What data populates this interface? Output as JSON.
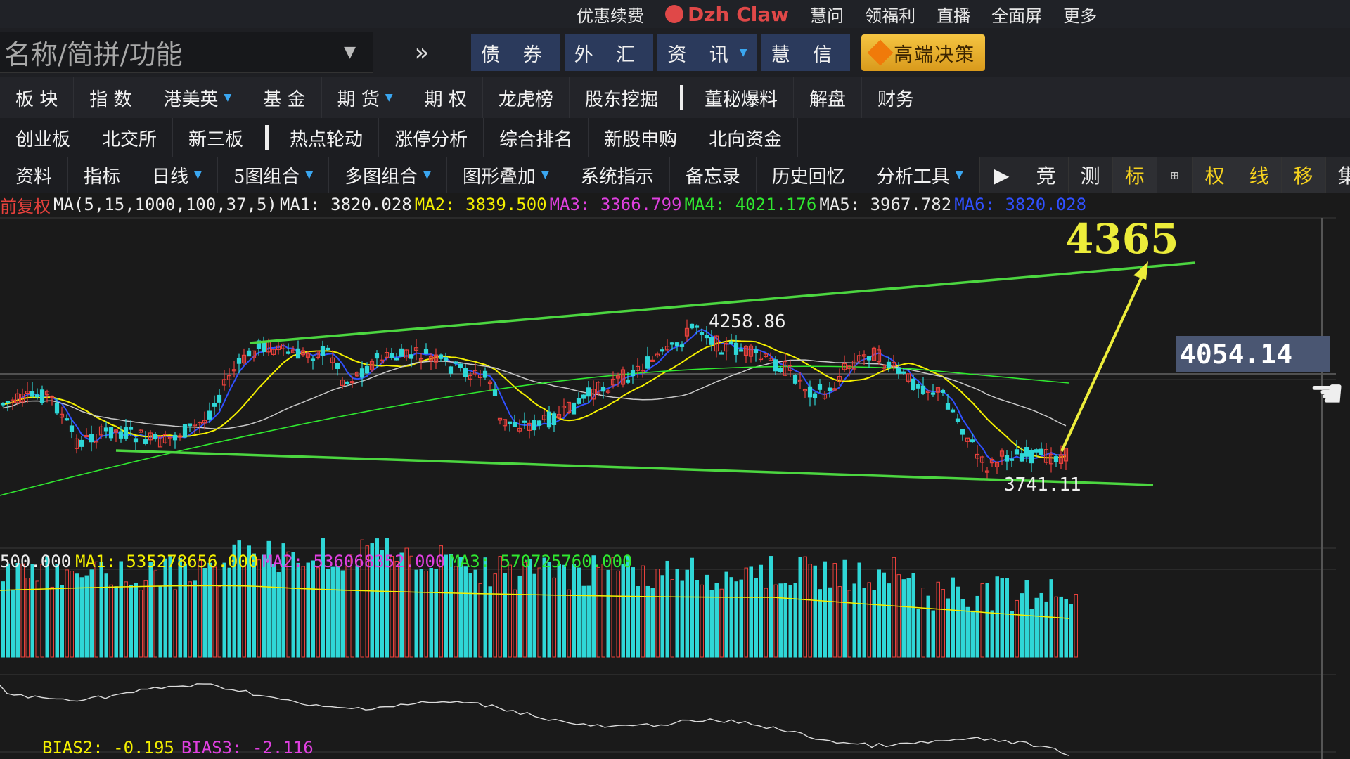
{
  "colors": {
    "up": "#e8413c",
    "down": "#2fd7d7",
    "channel": "#4cd640",
    "arrow": "#ecec3a",
    "ma1": "#f0f0f0",
    "ma2": "#f4f000",
    "ma3": "#e040e0",
    "ma4": "#30e830",
    "ma5": "#e8e8e8",
    "ma6": "#3050ff"
  },
  "topbar": {
    "promo": "优惠续费",
    "brand": "Dzh Claw",
    "items": [
      "慧问",
      "领福利",
      "直播",
      "全面屏",
      "更多"
    ]
  },
  "search": {
    "placeholder": "名称/简拼/功能",
    "more": "»"
  },
  "markets": [
    {
      "label": "债 券"
    },
    {
      "label": "外 汇"
    },
    {
      "label": "资 讯",
      "dropdown": true
    },
    {
      "label": "慧 信"
    }
  ],
  "premium": {
    "label": "高端决策",
    "icon": "diamond-icon"
  },
  "row2": [
    {
      "label": "板 块"
    },
    {
      "label": "指 数"
    },
    {
      "label": "港美英",
      "dropdown": true
    },
    {
      "label": "基 金"
    },
    {
      "label": "期 货",
      "dropdown": true
    },
    {
      "label": "期 权"
    },
    {
      "label": "龙虎榜"
    },
    {
      "label": "股东挖掘"
    },
    {
      "sep": true
    },
    {
      "label": "董秘爆料"
    },
    {
      "label": "解盘"
    },
    {
      "label": "财务"
    }
  ],
  "row3": [
    {
      "label": "创业板"
    },
    {
      "label": "北交所"
    },
    {
      "label": "新三板"
    },
    {
      "sep": true
    },
    {
      "label": "热点轮动"
    },
    {
      "label": "涨停分析"
    },
    {
      "label": "综合排名"
    },
    {
      "label": "新股申购"
    },
    {
      "label": "北向资金"
    }
  ],
  "row4": [
    {
      "label": "资料"
    },
    {
      "label": "指标"
    },
    {
      "label": "日线",
      "dropdown": true
    },
    {
      "label": "5图组合",
      "dropdown": true
    },
    {
      "label": "多图组合",
      "dropdown": true
    },
    {
      "label": "图形叠加",
      "dropdown": true
    },
    {
      "label": "系统指示"
    },
    {
      "label": "备忘录"
    },
    {
      "label": "历史回忆"
    },
    {
      "label": "分析工具",
      "dropdown": true
    }
  ],
  "tools": [
    {
      "label": "▶"
    },
    {
      "label": "竞"
    },
    {
      "label": "测"
    },
    {
      "label": "标",
      "yellow": true
    },
    {
      "label": "⊞",
      "small": true
    },
    {
      "label": "权",
      "yellow": true
    },
    {
      "label": "线",
      "yellow": true
    },
    {
      "label": "移",
      "yellow": true
    },
    {
      "label": "集"
    },
    {
      "label": "▫",
      "small": true
    },
    {
      "label": "▫",
      "small": true
    }
  ],
  "ma_legend": {
    "adj": "前复权",
    "params": "MA(5,15,1000,100,37,5)",
    "items": [
      {
        "name": "MA1",
        "value": "3820.028"
      },
      {
        "name": "MA2",
        "value": "3839.500"
      },
      {
        "name": "MA3",
        "value": "3366.799"
      },
      {
        "name": "MA4",
        "value": "4021.176"
      },
      {
        "name": "MA5",
        "value": "3967.782"
      },
      {
        "name": "MA6",
        "value": "3820.028"
      }
    ]
  },
  "price_tag": "4054.14",
  "annotations": {
    "target": "4365",
    "high": "4258.86",
    "low": "3741.11"
  },
  "volume_legend": {
    "vol": "500.000",
    "items": [
      {
        "name": "MA1",
        "value": "535278656.000"
      },
      {
        "name": "MA2",
        "value": "536068352.000"
      },
      {
        "name": "MA3",
        "value": "570725760.000"
      }
    ]
  },
  "bias_legend": [
    {
      "name": "BIAS2",
      "value": "-0.195"
    },
    {
      "name": "BIAS3",
      "value": "-2.116"
    }
  ]
}
